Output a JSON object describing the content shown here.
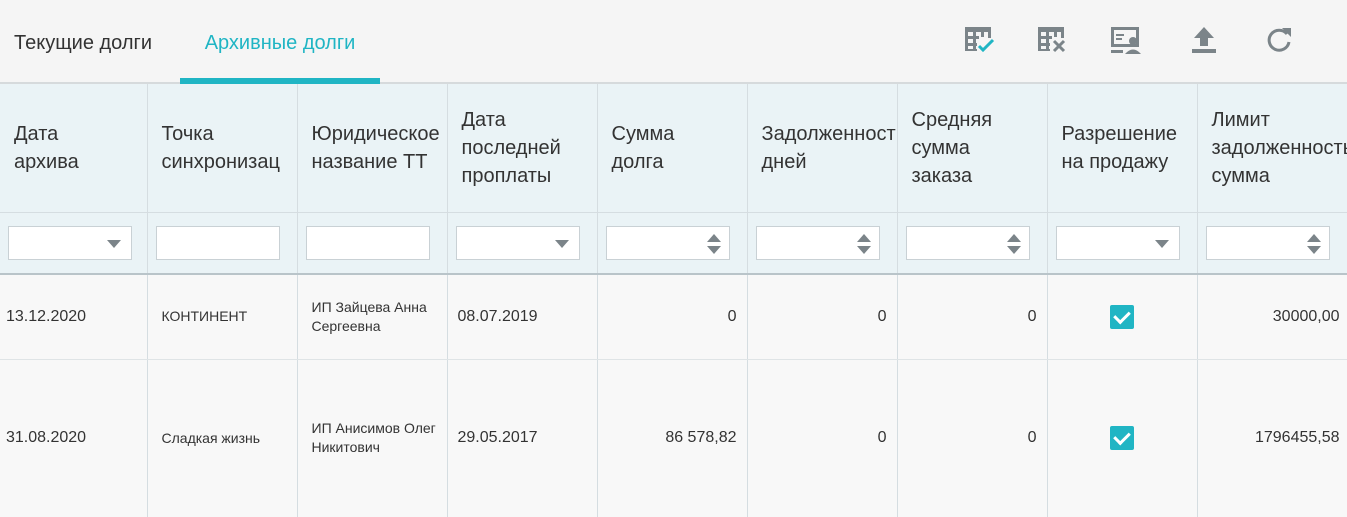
{
  "tabs": [
    {
      "label": "Текущие долги",
      "active": false
    },
    {
      "label": "Архивные долги",
      "active": true
    }
  ],
  "toolbar": {
    "icons": [
      "table-check-icon",
      "table-remove-icon",
      "table-user-icon",
      "upload-icon",
      "refresh-icon"
    ]
  },
  "colors": {
    "accent": "#20b5c4",
    "header_bg": "#eaf3f6",
    "icon": "#7b8489"
  },
  "grid": {
    "columns": [
      {
        "label": "Дата\nархива",
        "filter": "dropdown"
      },
      {
        "label": "Точка\nсинхронизац",
        "filter": "text"
      },
      {
        "label": "Юридическое\nназвание ТТ",
        "filter": "text"
      },
      {
        "label": "Дата\nпоследней\nпроплаты",
        "filter": "dropdown"
      },
      {
        "label": "Сумма\nдолга",
        "filter": "number"
      },
      {
        "label": "Задолженность\nдней",
        "filter": "number"
      },
      {
        "label": "Средняя\nсумма\nзаказа",
        "filter": "number"
      },
      {
        "label": "Разрешение\nна продажу",
        "filter": "dropdown"
      },
      {
        "label": "Лимит\nзадолженность\nсумма",
        "filter": "number"
      }
    ],
    "rows": [
      {
        "archive_date": "13.12.2020",
        "sync_point": "КОНТИНЕНТ",
        "legal_name": "ИП Зайцева Анна Сергеевна",
        "last_payment_date": "08.07.2019",
        "debt_sum": "0",
        "debt_days": "0",
        "avg_order": "0",
        "sale_permitted": true,
        "debt_limit": "30000,00"
      },
      {
        "archive_date": "31.08.2020",
        "sync_point": "Сладкая жизнь",
        "legal_name": "ИП Анисимов Олег Никитович",
        "last_payment_date": "29.05.2017",
        "debt_sum": "86 578,82",
        "debt_days": "0",
        "avg_order": "0",
        "sale_permitted": true,
        "debt_limit": "1796455,58"
      }
    ]
  }
}
